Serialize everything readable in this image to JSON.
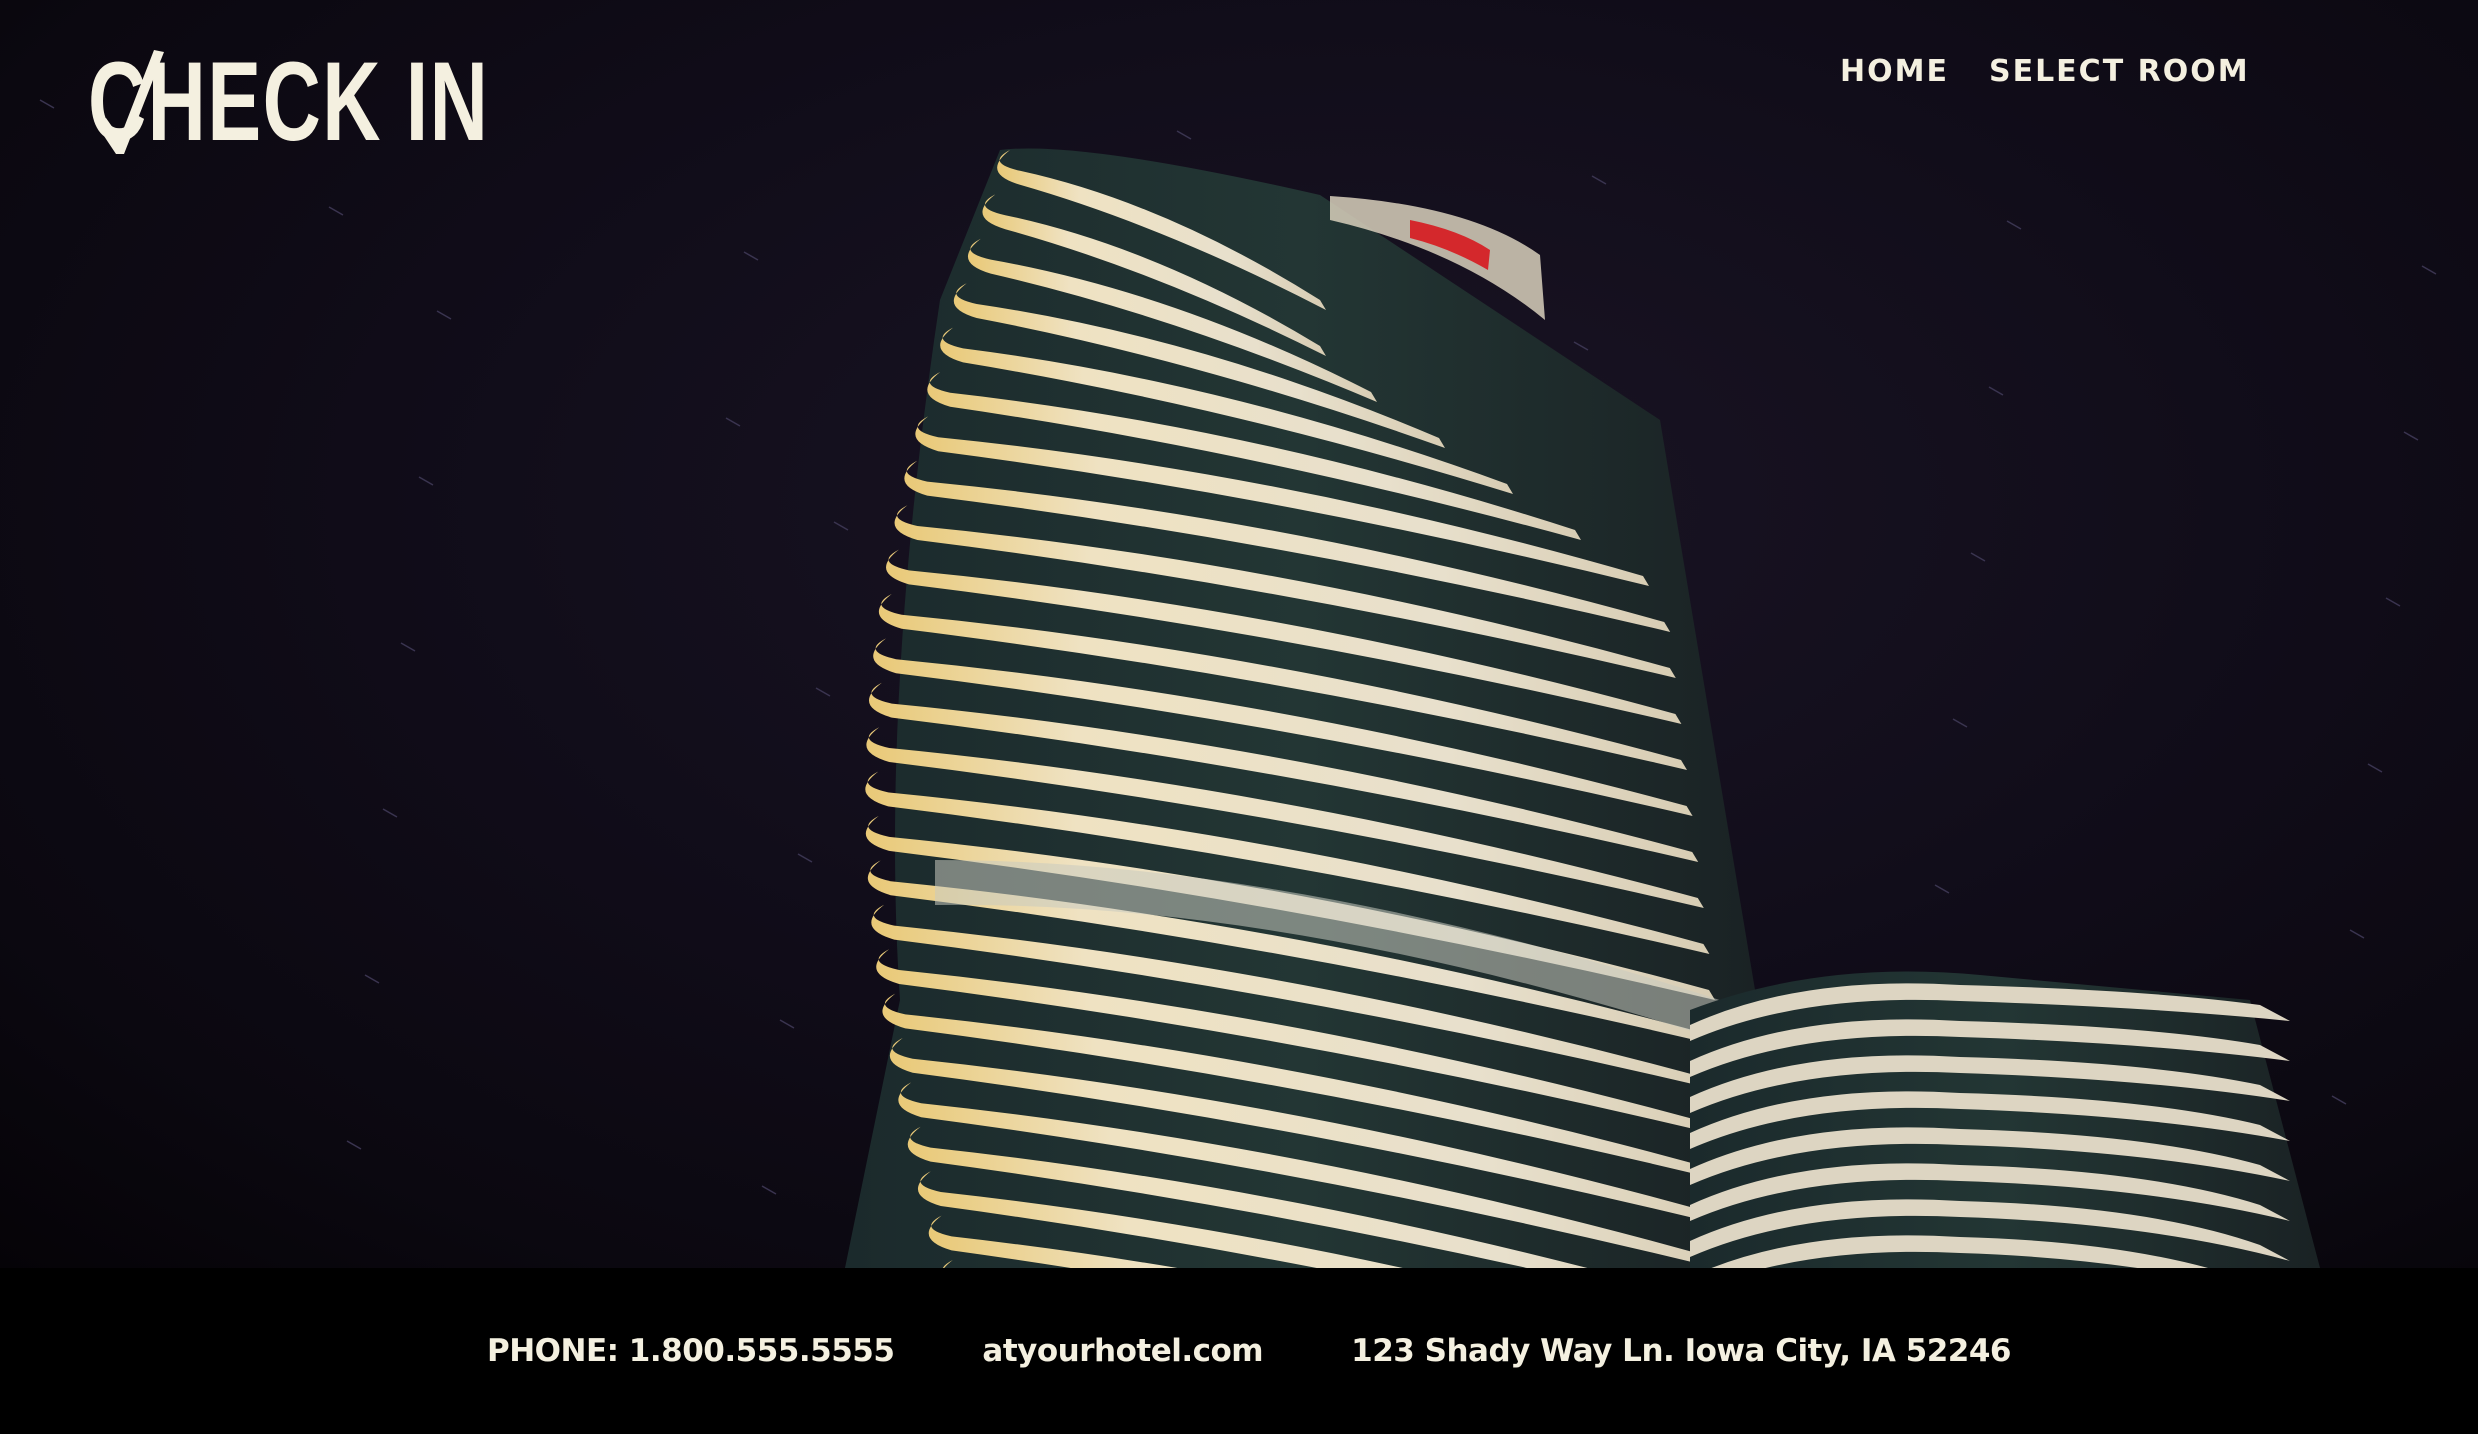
{
  "header": {
    "logo_text": "CHECK IN"
  },
  "nav": {
    "items": [
      {
        "label": "HOME"
      },
      {
        "label": "SELECT ROOM"
      }
    ]
  },
  "hero": {
    "image_subject": "curved-tower-hotel-at-night"
  },
  "footer": {
    "phone": "PHONE: 1.800.555.5555",
    "website": "atyourhotel.com",
    "address": "123 Shady Way Ln. Iowa City, IA 52246"
  },
  "colors": {
    "text": "#f4f0e0",
    "background": "#000000",
    "sky": "#110d1a",
    "building_band": "#e8dcc0"
  }
}
